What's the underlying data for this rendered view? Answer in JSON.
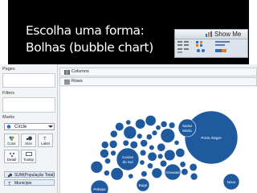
{
  "slide": {
    "title_line1": "Escolha uma forma:",
    "title_line2": "Bolhas (bubble chart)"
  },
  "show_me": {
    "label": "Show Me"
  },
  "sidebar": {
    "pages": "Pages",
    "filters": "Filters",
    "marks": "Marks",
    "mark_type": "Circle",
    "buttons": [
      "Color",
      "Size",
      "Label",
      "Detail",
      "Tooltip"
    ],
    "pills": [
      "SUM(População Total)",
      "Município"
    ]
  },
  "shelves": {
    "columns": "Columns",
    "rows": "Rows"
  },
  "bubbles": {
    "color": "#1f5a9e",
    "labels": [
      "Porto Alegre",
      "Santa Maria",
      "Caxias do Sul",
      "Gravataí",
      "Novo",
      "Pelotas",
      "Bagé"
    ]
  }
}
